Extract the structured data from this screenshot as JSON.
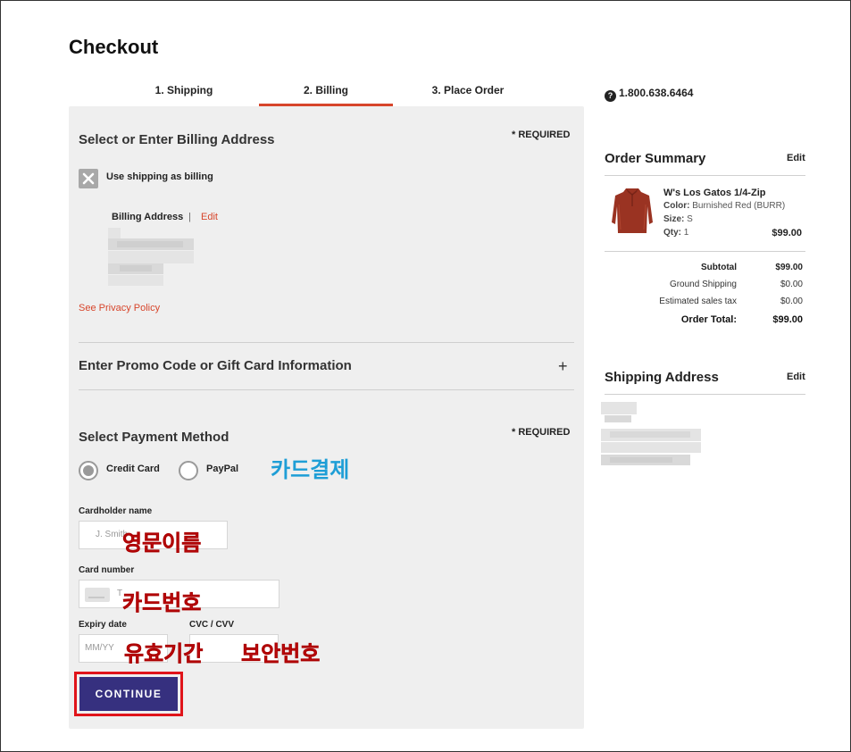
{
  "page": {
    "title": "Checkout"
  },
  "steps": {
    "shipping": "1. Shipping",
    "billing": "2. Billing",
    "place_order": "3. Place Order"
  },
  "billing": {
    "section_title": "Select or Enter Billing Address",
    "required": "* REQUIRED",
    "use_shipping_label": "Use shipping as billing",
    "address_label": "Billing Address",
    "separator": "|",
    "edit": "Edit",
    "privacy_link": "See Privacy Policy"
  },
  "promo": {
    "title": "Enter Promo Code or Gift Card Information",
    "expand": "+"
  },
  "payment": {
    "title": "Select Payment Method",
    "required": "* REQUIRED",
    "credit_card": "Credit Card",
    "paypal": "PayPal",
    "cardholder_label": "Cardholder name",
    "cardholder_placeholder": "J. Smith",
    "card_number_label": "Card number",
    "card_number_placeholder": "T",
    "expiry_label": "Expiry date",
    "expiry_placeholder": "MM/YY",
    "cvc_label": "CVC / CVV",
    "continue": "CONTINUE"
  },
  "annotations": {
    "card_payment": "카드결제",
    "english_name": "영문이름",
    "card_number": "카드번호",
    "expiry": "유효기간",
    "security_code": "보안번호"
  },
  "contact": {
    "phone": "1.800.638.6464",
    "phone_icon": "?"
  },
  "order_summary": {
    "title": "Order Summary",
    "edit": "Edit",
    "item": {
      "name": "W's Los Gatos 1/4-Zip",
      "color_label": "Color:",
      "color": "Burnished Red (BURR)",
      "size_label": "Size:",
      "size": "S",
      "qty_label": "Qty:",
      "qty": "1",
      "price": "$99.00"
    },
    "subtotal_label": "Subtotal",
    "subtotal": "$99.00",
    "shipping_label": "Ground Shipping",
    "shipping": "$0.00",
    "tax_label": "Estimated sales tax",
    "tax": "$0.00",
    "total_label": "Order Total:",
    "total": "$99.00"
  },
  "shipping_address": {
    "title": "Shipping Address",
    "edit": "Edit"
  }
}
